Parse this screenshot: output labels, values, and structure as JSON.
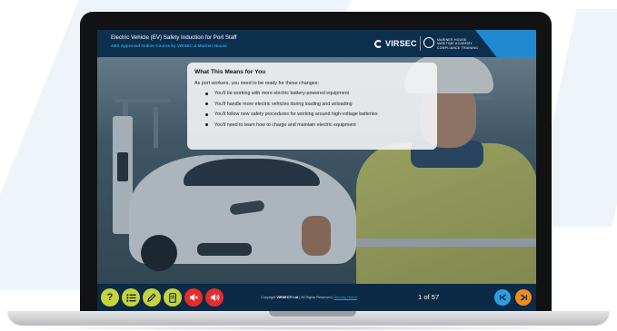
{
  "course": {
    "title": "Electric Vehicle (EV) Safety Induction for Port Staff",
    "subtitle": "ABS Approved Online Course by VIRSEC & Mariner House"
  },
  "branding": {
    "virsec_logo": "VIRSEC",
    "mariner_house_logo": "MARINER HOUSE\nMARITIME ACADEMY\nCOMPLIANCE TRAINING"
  },
  "card": {
    "title": "What This Means for You",
    "intro": "As port workers, you need to be ready for these changes:",
    "items": [
      "You'll be working with more electric battery-powered equipment",
      "You'll handle more electric vehicles during loading and unloading",
      "You'll follow new safety procedures for working around high-voltage batteries",
      "You'll need to learn how to charge and maintain electric equipment"
    ]
  },
  "footer": {
    "copyright_prefix": "Copyright ",
    "copyright_brand": "VIRSEC® Ltd",
    "copyright_rest": " | All Rights Reserved | ",
    "security_link": "Security Notice",
    "page_counter": "1 of 57",
    "controls": [
      {
        "icon": "help-icon",
        "color": "#c8d33a"
      },
      {
        "icon": "menu-list-icon",
        "color": "#c8d33a"
      },
      {
        "icon": "pencil-icon",
        "color": "#c8d33a"
      },
      {
        "icon": "document-icon",
        "color": "#c8d33a"
      },
      {
        "icon": "sound-off-icon",
        "color": "#e52d2d"
      },
      {
        "icon": "sound-on-icon",
        "color": "#e52d2d"
      }
    ],
    "nav": {
      "first_color": "#2d9fe0",
      "last_color": "#f28c1f"
    }
  },
  "colors": {
    "header_bg": "#0d2f4e",
    "accent_blue": "#1f8ad0",
    "subtitle_blue": "#2d9fe0"
  }
}
